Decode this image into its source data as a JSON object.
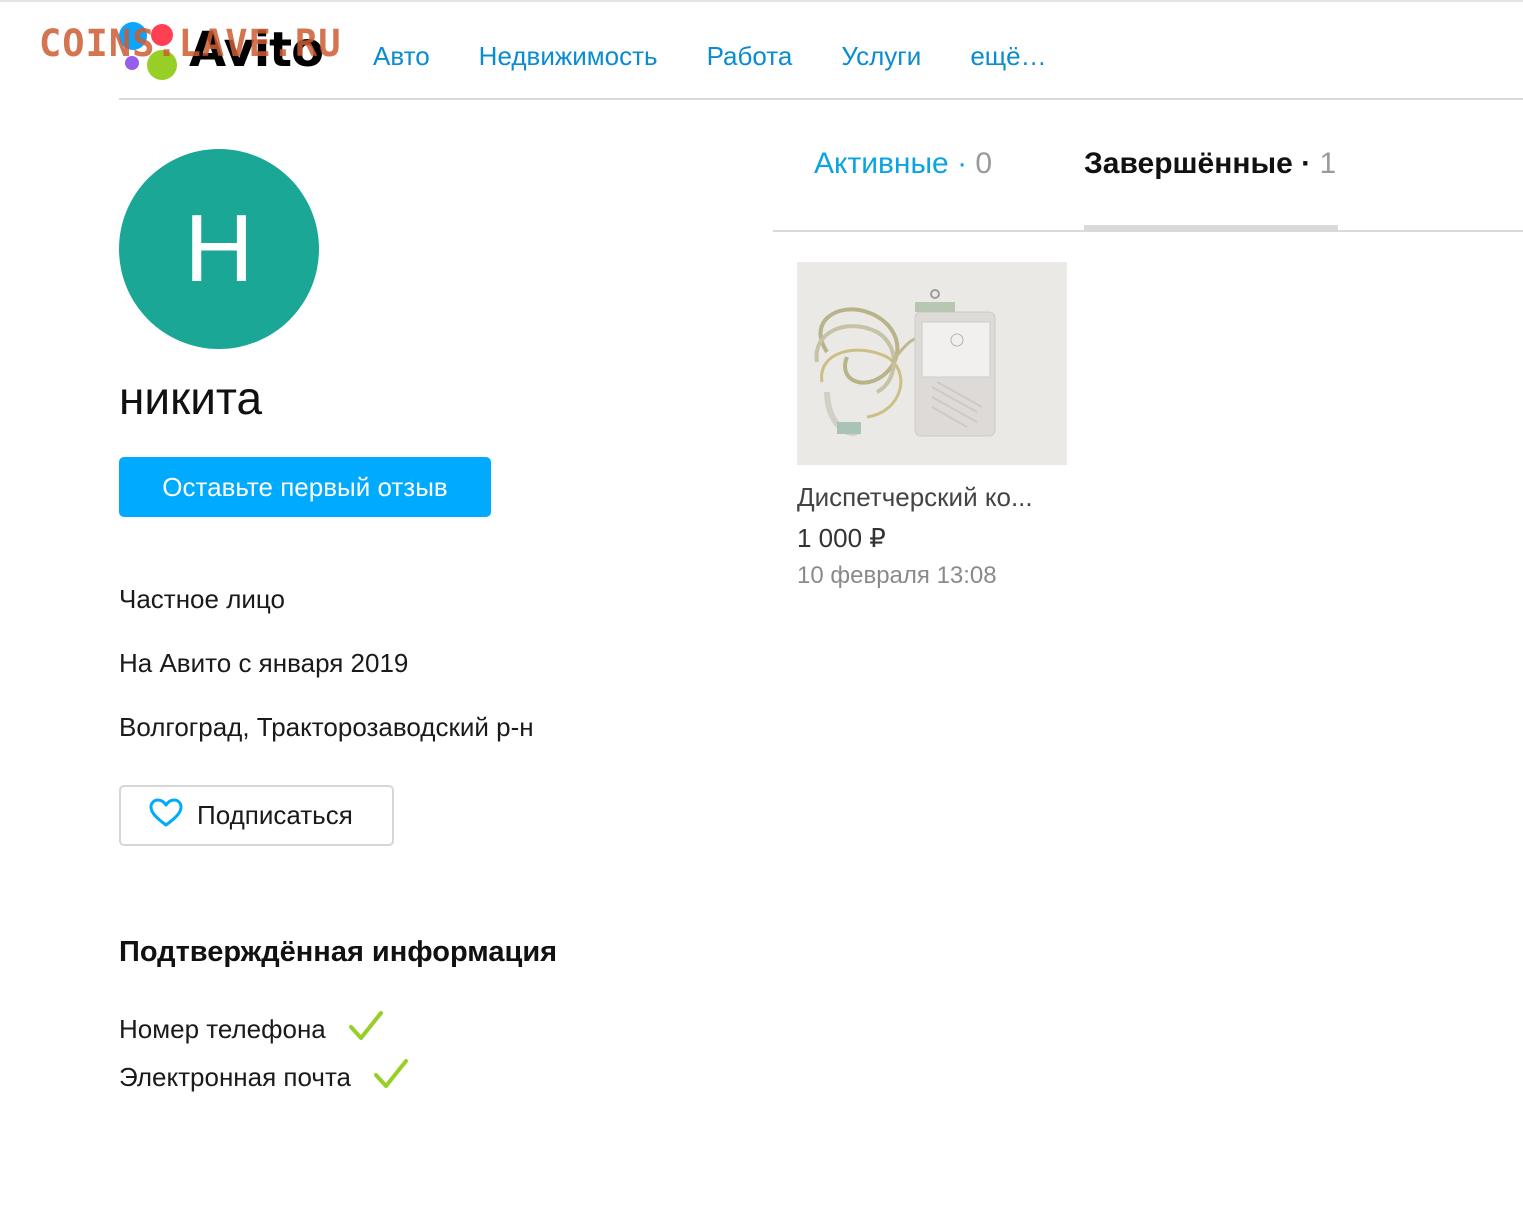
{
  "header": {
    "logo_text": "Avito",
    "watermark": "COINS.LAVE.RU",
    "nav": [
      "Авто",
      "Недвижимость",
      "Работа",
      "Услуги",
      "ещё…"
    ]
  },
  "profile": {
    "avatar_letter": "Н",
    "avatar_color": "#1aa795",
    "name": "никита",
    "review_button": "Оставьте первый отзыв",
    "seller_type": "Частное лицо",
    "member_since": "На Авито с января 2019",
    "location": "Волгоград, Тракторозаводский р-н",
    "subscribe_button": "Подписаться"
  },
  "verified": {
    "title": "Подтверждённая информация",
    "items": [
      "Номер телефона",
      "Электронная почта"
    ]
  },
  "tabs": {
    "active_label": "Активные",
    "active_count": "0",
    "completed_label": "Завершённые",
    "completed_count": "1",
    "separator": " · "
  },
  "listing": {
    "title": "Диспетчерский ко...",
    "price": "1 000 ₽",
    "date": "10 февраля 13:08"
  },
  "colors": {
    "accent": "#00aaff",
    "link": "#0a8cd0",
    "check": "#97cf26"
  }
}
